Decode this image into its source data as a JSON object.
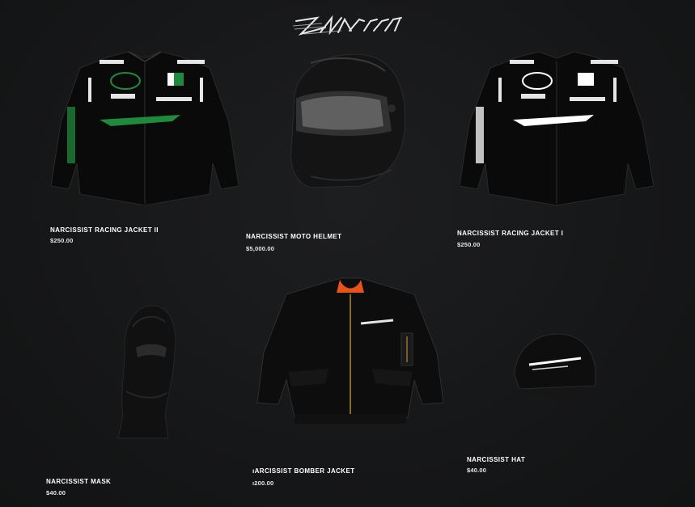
{
  "brand": {
    "logo_icon": "narcissist-script-logo-icon"
  },
  "products": [
    {
      "name": "NARCISSIST RACING JACKET II",
      "price": "$250.00",
      "icon": "racing-jacket-green-icon",
      "accent": "#1f8a3c"
    },
    {
      "name": "NARCISSIST MOTO HELMET",
      "price": "$5,000.00",
      "icon": "helmet-icon"
    },
    {
      "name": "NARCISSIST RACING JACKET I",
      "price": "$250.00",
      "icon": "racing-jacket-white-icon",
      "accent": "#ffffff"
    },
    {
      "name": "NARCISSIST MASK",
      "price": "$40.00",
      "icon": "balaclava-icon"
    },
    {
      "name": "ıARCISSIST BOMBER JACKET",
      "price": "ı200.00",
      "icon": "bomber-jacket-icon",
      "accent": "#e8531a"
    },
    {
      "name": "NARCISSIST HAT",
      "price": "$40.00",
      "icon": "cap-icon"
    }
  ]
}
